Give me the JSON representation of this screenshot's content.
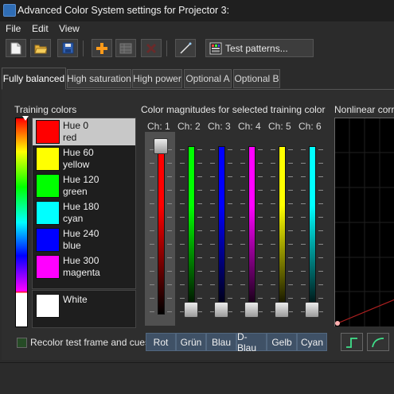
{
  "window": {
    "title": "Advanced Color System settings for Projector 3:"
  },
  "menu": [
    "File",
    "Edit",
    "View"
  ],
  "toolbar": {
    "icons": [
      "new-document-icon",
      "open-folder-icon",
      "save-disk-icon",
      "add-plus-icon",
      "grid-icon",
      "delete-x-icon",
      "line-tool-icon",
      "test-patterns-icon"
    ],
    "test_patterns_label": "Test patterns..."
  },
  "tabs": [
    {
      "label": "Fully balanced",
      "active": true
    },
    {
      "label": "High saturation",
      "active": false
    },
    {
      "label": "High power",
      "active": false
    },
    {
      "label": "Optional A",
      "active": false
    },
    {
      "label": "Optional B",
      "active": false
    }
  ],
  "training": {
    "title": "Training colors",
    "items": [
      {
        "line1": "Hue 0",
        "line2": "red",
        "color": "#ff0000",
        "selected": true
      },
      {
        "line1": "Hue 60",
        "line2": "yellow",
        "color": "#ffff00",
        "selected": false
      },
      {
        "line1": "Hue 120",
        "line2": "green",
        "color": "#00ff00",
        "selected": false
      },
      {
        "line1": "Hue 180",
        "line2": "cyan",
        "color": "#00ffff",
        "selected": false
      },
      {
        "line1": "Hue 240",
        "line2": "blue",
        "color": "#0000ff",
        "selected": false
      },
      {
        "line1": "Hue 300",
        "line2": "magenta",
        "color": "#ff00ff",
        "selected": false
      }
    ],
    "white_label": "White",
    "white_color": "#ffffff",
    "recolor_label": "Recolor test frame and cues"
  },
  "magnitudes": {
    "title": "Color magnitudes for selected training color",
    "channels": [
      {
        "label": "Ch: 1",
        "color": "#ff0000",
        "level": 1.0,
        "button": "Rot"
      },
      {
        "label": "Ch: 2",
        "color": "#00ff00",
        "level": 0.0,
        "button": "Grün"
      },
      {
        "label": "Ch: 3",
        "color": "#0000ff",
        "level": 0.0,
        "button": "Blau"
      },
      {
        "label": "Ch: 4",
        "color": "#ff00ff",
        "level": 0.0,
        "button": "D-Blau"
      },
      {
        "label": "Ch: 5",
        "color": "#ffff00",
        "level": 0.0,
        "button": "Gelb"
      },
      {
        "label": "Ch: 6",
        "color": "#00ffff",
        "level": 0.0,
        "button": "Cyan"
      }
    ]
  },
  "nonlinear": {
    "title": "Nonlinear correc",
    "curve_buttons": [
      "step-curve-icon",
      "smooth-curve-icon"
    ]
  }
}
